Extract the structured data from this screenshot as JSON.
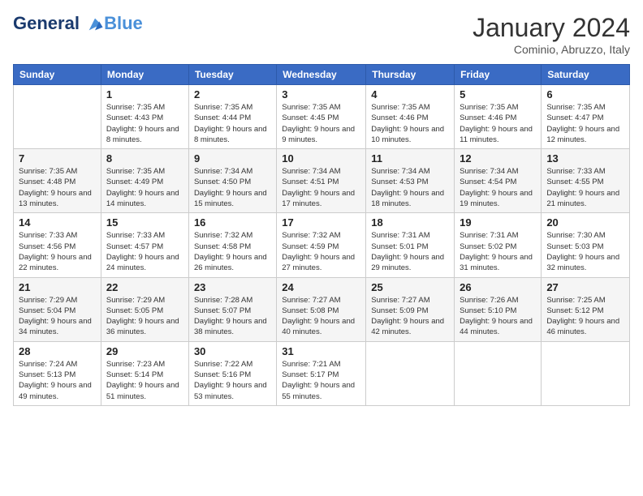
{
  "header": {
    "logo_line1": "General",
    "logo_line2": "Blue",
    "month": "January 2024",
    "location": "Cominio, Abruzzo, Italy"
  },
  "days_of_week": [
    "Sunday",
    "Monday",
    "Tuesday",
    "Wednesday",
    "Thursday",
    "Friday",
    "Saturday"
  ],
  "weeks": [
    [
      {
        "day": "",
        "sunrise": "",
        "sunset": "",
        "daylight": ""
      },
      {
        "day": "1",
        "sunrise": "Sunrise: 7:35 AM",
        "sunset": "Sunset: 4:43 PM",
        "daylight": "Daylight: 9 hours and 8 minutes."
      },
      {
        "day": "2",
        "sunrise": "Sunrise: 7:35 AM",
        "sunset": "Sunset: 4:44 PM",
        "daylight": "Daylight: 9 hours and 8 minutes."
      },
      {
        "day": "3",
        "sunrise": "Sunrise: 7:35 AM",
        "sunset": "Sunset: 4:45 PM",
        "daylight": "Daylight: 9 hours and 9 minutes."
      },
      {
        "day": "4",
        "sunrise": "Sunrise: 7:35 AM",
        "sunset": "Sunset: 4:46 PM",
        "daylight": "Daylight: 9 hours and 10 minutes."
      },
      {
        "day": "5",
        "sunrise": "Sunrise: 7:35 AM",
        "sunset": "Sunset: 4:46 PM",
        "daylight": "Daylight: 9 hours and 11 minutes."
      },
      {
        "day": "6",
        "sunrise": "Sunrise: 7:35 AM",
        "sunset": "Sunset: 4:47 PM",
        "daylight": "Daylight: 9 hours and 12 minutes."
      }
    ],
    [
      {
        "day": "7",
        "sunrise": "Sunrise: 7:35 AM",
        "sunset": "Sunset: 4:48 PM",
        "daylight": "Daylight: 9 hours and 13 minutes."
      },
      {
        "day": "8",
        "sunrise": "Sunrise: 7:35 AM",
        "sunset": "Sunset: 4:49 PM",
        "daylight": "Daylight: 9 hours and 14 minutes."
      },
      {
        "day": "9",
        "sunrise": "Sunrise: 7:34 AM",
        "sunset": "Sunset: 4:50 PM",
        "daylight": "Daylight: 9 hours and 15 minutes."
      },
      {
        "day": "10",
        "sunrise": "Sunrise: 7:34 AM",
        "sunset": "Sunset: 4:51 PM",
        "daylight": "Daylight: 9 hours and 17 minutes."
      },
      {
        "day": "11",
        "sunrise": "Sunrise: 7:34 AM",
        "sunset": "Sunset: 4:53 PM",
        "daylight": "Daylight: 9 hours and 18 minutes."
      },
      {
        "day": "12",
        "sunrise": "Sunrise: 7:34 AM",
        "sunset": "Sunset: 4:54 PM",
        "daylight": "Daylight: 9 hours and 19 minutes."
      },
      {
        "day": "13",
        "sunrise": "Sunrise: 7:33 AM",
        "sunset": "Sunset: 4:55 PM",
        "daylight": "Daylight: 9 hours and 21 minutes."
      }
    ],
    [
      {
        "day": "14",
        "sunrise": "Sunrise: 7:33 AM",
        "sunset": "Sunset: 4:56 PM",
        "daylight": "Daylight: 9 hours and 22 minutes."
      },
      {
        "day": "15",
        "sunrise": "Sunrise: 7:33 AM",
        "sunset": "Sunset: 4:57 PM",
        "daylight": "Daylight: 9 hours and 24 minutes."
      },
      {
        "day": "16",
        "sunrise": "Sunrise: 7:32 AM",
        "sunset": "Sunset: 4:58 PM",
        "daylight": "Daylight: 9 hours and 26 minutes."
      },
      {
        "day": "17",
        "sunrise": "Sunrise: 7:32 AM",
        "sunset": "Sunset: 4:59 PM",
        "daylight": "Daylight: 9 hours and 27 minutes."
      },
      {
        "day": "18",
        "sunrise": "Sunrise: 7:31 AM",
        "sunset": "Sunset: 5:01 PM",
        "daylight": "Daylight: 9 hours and 29 minutes."
      },
      {
        "day": "19",
        "sunrise": "Sunrise: 7:31 AM",
        "sunset": "Sunset: 5:02 PM",
        "daylight": "Daylight: 9 hours and 31 minutes."
      },
      {
        "day": "20",
        "sunrise": "Sunrise: 7:30 AM",
        "sunset": "Sunset: 5:03 PM",
        "daylight": "Daylight: 9 hours and 32 minutes."
      }
    ],
    [
      {
        "day": "21",
        "sunrise": "Sunrise: 7:29 AM",
        "sunset": "Sunset: 5:04 PM",
        "daylight": "Daylight: 9 hours and 34 minutes."
      },
      {
        "day": "22",
        "sunrise": "Sunrise: 7:29 AM",
        "sunset": "Sunset: 5:05 PM",
        "daylight": "Daylight: 9 hours and 36 minutes."
      },
      {
        "day": "23",
        "sunrise": "Sunrise: 7:28 AM",
        "sunset": "Sunset: 5:07 PM",
        "daylight": "Daylight: 9 hours and 38 minutes."
      },
      {
        "day": "24",
        "sunrise": "Sunrise: 7:27 AM",
        "sunset": "Sunset: 5:08 PM",
        "daylight": "Daylight: 9 hours and 40 minutes."
      },
      {
        "day": "25",
        "sunrise": "Sunrise: 7:27 AM",
        "sunset": "Sunset: 5:09 PM",
        "daylight": "Daylight: 9 hours and 42 minutes."
      },
      {
        "day": "26",
        "sunrise": "Sunrise: 7:26 AM",
        "sunset": "Sunset: 5:10 PM",
        "daylight": "Daylight: 9 hours and 44 minutes."
      },
      {
        "day": "27",
        "sunrise": "Sunrise: 7:25 AM",
        "sunset": "Sunset: 5:12 PM",
        "daylight": "Daylight: 9 hours and 46 minutes."
      }
    ],
    [
      {
        "day": "28",
        "sunrise": "Sunrise: 7:24 AM",
        "sunset": "Sunset: 5:13 PM",
        "daylight": "Daylight: 9 hours and 49 minutes."
      },
      {
        "day": "29",
        "sunrise": "Sunrise: 7:23 AM",
        "sunset": "Sunset: 5:14 PM",
        "daylight": "Daylight: 9 hours and 51 minutes."
      },
      {
        "day": "30",
        "sunrise": "Sunrise: 7:22 AM",
        "sunset": "Sunset: 5:16 PM",
        "daylight": "Daylight: 9 hours and 53 minutes."
      },
      {
        "day": "31",
        "sunrise": "Sunrise: 7:21 AM",
        "sunset": "Sunset: 5:17 PM",
        "daylight": "Daylight: 9 hours and 55 minutes."
      },
      {
        "day": "",
        "sunrise": "",
        "sunset": "",
        "daylight": ""
      },
      {
        "day": "",
        "sunrise": "",
        "sunset": "",
        "daylight": ""
      },
      {
        "day": "",
        "sunrise": "",
        "sunset": "",
        "daylight": ""
      }
    ]
  ]
}
